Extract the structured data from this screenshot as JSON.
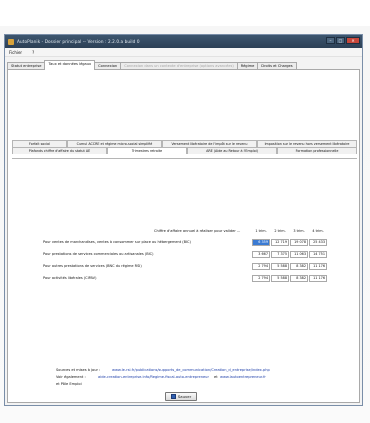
{
  "window": {
    "title": "AutoPlanik - Dossier principal -- Version : 2.2.0.a build 0",
    "menu": [
      "Fichier",
      "?"
    ],
    "controls": {
      "minimize": "–",
      "maximize": "□",
      "close": "✕"
    }
  },
  "tabs": [
    {
      "label": "Statut entreprise"
    },
    {
      "label": "Taux et données légaux"
    },
    {
      "label": "Connexion"
    },
    {
      "label": "Connexion dans un contexte d'entreprise (options avancées)"
    },
    {
      "label": "Régime"
    },
    {
      "label": "Droits et Charges"
    }
  ],
  "subtabs_row1": [
    {
      "label": "Forfait social"
    },
    {
      "label": "Cumul ACCRE et régime micro-social simplifié"
    },
    {
      "label": "Versement libératoire de l'impôt sur le revenu"
    },
    {
      "label": "Imposition sur le revenu hors versement libératoire"
    }
  ],
  "subtabs_row2": [
    {
      "label": "Plafonds chiffre d'affaire du statut AE"
    },
    {
      "label": "Trimestres retraite"
    },
    {
      "label": "ARE (Aide au Retour à l'Emploi)"
    },
    {
      "label": "Formation professionnelle"
    }
  ],
  "grid": {
    "header_label": "Chiffre d'affaire annuel à réaliser pour valider ...",
    "columns": [
      "1 trim.",
      "2 trim.",
      "3 trim.",
      "4 trim."
    ],
    "rows": [
      {
        "label": "Pour ventes de marchandises, ventes à consommer sur place ou hébergement  (BIC)",
        "values": [
          "6 359",
          "12 719",
          "19 078",
          "25 433"
        ]
      },
      {
        "label": "Pour prestations de services commerciales ou artisanales (BIC)",
        "values": [
          "3 667",
          "7 375",
          "11 063",
          "14 751"
        ]
      },
      {
        "label": "Pour autres prestations de services (BNC du régime RSI)",
        "values": [
          "2 794",
          "5 588",
          "8 382",
          "11 176"
        ]
      },
      {
        "label": "Pour activités libérales (CIPAV)",
        "values": [
          "2 794",
          "5 588",
          "8 382",
          "11 176"
        ]
      }
    ]
  },
  "footer": {
    "sources_label": "Sources et mises à jour :",
    "sources_link": "www.le-rsi.fr/publications/supports_de_communication/Creation_d_entreprise/index.php",
    "see_also_label": "Voir également :",
    "see_also_link1": "aide-creation-entreprise.info/Regime-fiscal-auto-entrepreneur",
    "and": "et",
    "see_also_link2": "www.lautoentrepreneur.fr",
    "pole_emploi": "et Pôle Emploi"
  },
  "save_label": "Sauver"
}
